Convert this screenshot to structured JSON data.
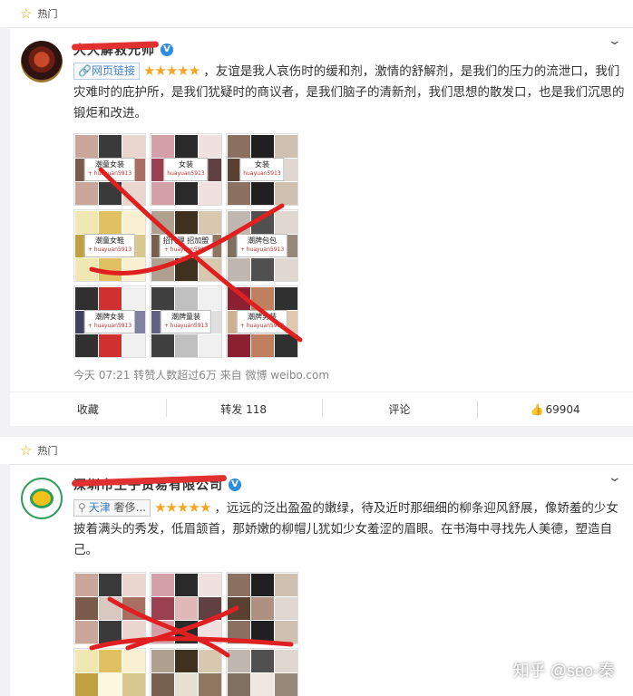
{
  "feed": [
    {
      "section_label": "热门",
      "author": "大大解救元帅",
      "tag_label": "网页链接",
      "stars": "★★★★★",
      "text": "，友谊是我人哀伤时的缓和剂，激情的舒解剂，是我们的压力的流泄口，我们灾难时的庇护所，是我们犹疑时的商议者，是我们脑子的清新剂，我们思想的散发口，也是我们沉思的锻炬和改进。",
      "thumbs": [
        {
          "label": "潮童女装",
          "sub": "+ huayuan5913"
        },
        {
          "label": "女装",
          "sub": "huayuan5913"
        },
        {
          "label": "潮童女鞋",
          "sub": "+ huayuan5913"
        },
        {
          "label": "招代理 招加盟",
          "sub": "+ huayuan5913"
        },
        {
          "label": "潮牌包包",
          "sub": "+ huayuan5913"
        },
        {
          "label": "潮牌女装",
          "sub": "+ huayuan5913"
        },
        {
          "label": "潮牌童装",
          "sub": "+ huayuan5913"
        },
        {
          "label": "潮牌男装",
          "sub": "+ huayuan5913"
        }
      ],
      "meta": "今天 07:21 转赞人数超过6万 来自 微博 weibo.com",
      "actions": {
        "fav": "收藏",
        "repost": "转发 118",
        "comment": "评论",
        "like": "69904"
      }
    },
    {
      "section_label": "热门",
      "author": "深圳市王子贸易有限公司",
      "tag_city": "天津",
      "tag_rest": "奢侈...",
      "stars": "★★★★★",
      "text": "，远远的泛出盈盈的嫩绿，待及近时那细细的柳条迎风舒展，像娇羞的少女披着满头的秀发，低眉颔首，那娇嫩的柳帽儿犹如少女羞涩的眉眼。在书海中寻找先人美德，塑造自己。",
      "thumbs": [
        {
          "label": "",
          "sub": ""
        },
        {
          "label": "",
          "sub": ""
        },
        {
          "label": "",
          "sub": ""
        },
        {
          "label": "",
          "sub": ""
        },
        {
          "label": "",
          "sub": ""
        },
        {
          "label": "",
          "sub": ""
        }
      ]
    }
  ],
  "watermark": "知乎 @seo-秦",
  "icons": {
    "section": "star-icon",
    "menu": "chevron-down-icon",
    "verified": "verified-icon",
    "location": "location-pin-icon",
    "like": "thumbs-up-icon"
  }
}
